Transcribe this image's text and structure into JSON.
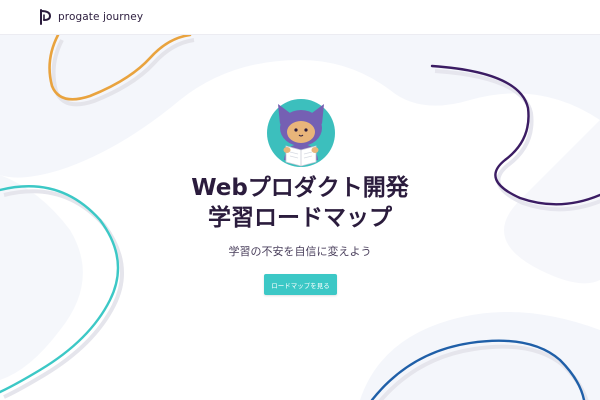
{
  "header": {
    "logo_text": "progate journey",
    "logo_icon": "progate-logo-icon"
  },
  "hero": {
    "mascot_icon": "ninja-cat-mascot-icon",
    "title_line1": "Webプロダクト開発",
    "title_line2": "学習ロードマップ",
    "subtitle": "学習の不安を自信に変えよう",
    "cta_label": "ロードマップを見る"
  },
  "colors": {
    "accent_teal": "#3cc8c6",
    "curve_orange": "#e9a33e",
    "curve_purple": "#3b1c63",
    "curve_blue": "#1f5fa8",
    "text_dark": "#2b1c3d"
  }
}
